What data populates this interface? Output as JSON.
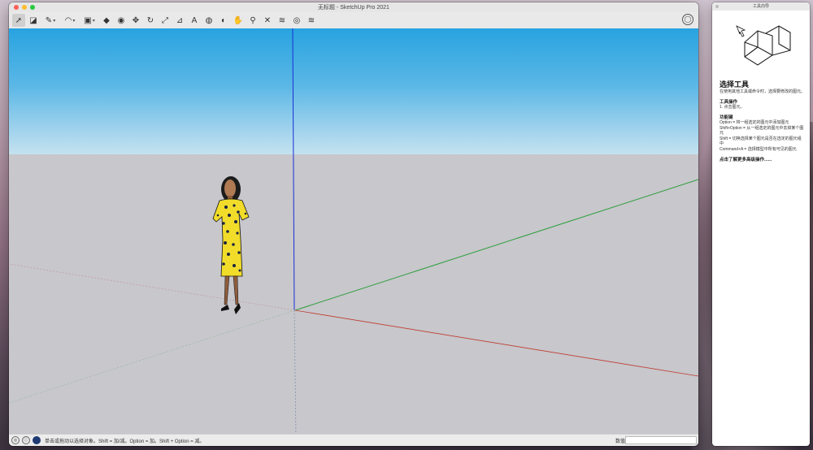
{
  "window": {
    "title": "无标题 - SketchUp Pro 2021"
  },
  "toolbar": {
    "tools": [
      {
        "name": "select-tool-icon",
        "glyph": "➚",
        "active": true
      },
      {
        "name": "eraser-tool-icon",
        "glyph": "◪"
      },
      {
        "name": "line-tool-icon",
        "glyph": "✎",
        "dropdown": true
      },
      {
        "name": "arc-tool-icon",
        "glyph": "◠",
        "dropdown": true
      },
      {
        "name": "shape-tool-icon",
        "glyph": "▣",
        "dropdown": true
      },
      {
        "name": "push-pull-tool-icon",
        "glyph": "◆"
      },
      {
        "name": "offset-tool-icon",
        "glyph": "◉"
      },
      {
        "name": "move-tool-icon",
        "glyph": "✥"
      },
      {
        "name": "rotate-tool-icon",
        "glyph": "↻"
      },
      {
        "name": "scale-tool-icon",
        "glyph": "⤢"
      },
      {
        "name": "tape-measure-tool-icon",
        "glyph": "⊿"
      },
      {
        "name": "text-tool-icon",
        "glyph": "A"
      },
      {
        "name": "paint-bucket-tool-icon",
        "glyph": "◍"
      },
      {
        "name": "orbit-tool-icon",
        "glyph": "◐"
      },
      {
        "name": "pan-tool-icon",
        "glyph": "✋"
      },
      {
        "name": "zoom-tool-icon",
        "glyph": "⚲"
      },
      {
        "name": "zoom-extents-tool-icon",
        "glyph": "✕"
      },
      {
        "name": "warehouse-icon",
        "glyph": "≋"
      },
      {
        "name": "extension-warehouse-icon",
        "glyph": "◎"
      },
      {
        "name": "layout-icon",
        "glyph": "≋"
      }
    ]
  },
  "status": {
    "hint": "单击或拖动以选择对象。Shift = 加/减。Option = 加。Shift + Option = 减。",
    "measure_label": "数值",
    "measure_value": ""
  },
  "tray": {
    "window_title": "工具向导",
    "tool_title": "选择工具",
    "tool_desc": "在使用其他工具或命令时，选择要修改的图元。",
    "ops_heading": "工具操作",
    "ops_item": "1. 点击图元。",
    "keys_heading": "功能键",
    "keys_text_1": "Option = 将一组选定的图元中添加图元",
    "keys_text_2": "Shift+Option = 从一组选定的图元中去掉某个图元",
    "keys_text_3": "Shift = 切换选择某个图元是否在选定的图元组中",
    "keys_text_4": "Command+A = 选择模型中所有可见的图元",
    "more_link": "点击了解更多高级操作......"
  },
  "colors": {
    "sky_top": "#28a3e0",
    "ground": "#c7c7cc",
    "axis_red": "#c0392b",
    "axis_green": "#2e9e3a",
    "axis_blue": "#1a2fd6"
  }
}
